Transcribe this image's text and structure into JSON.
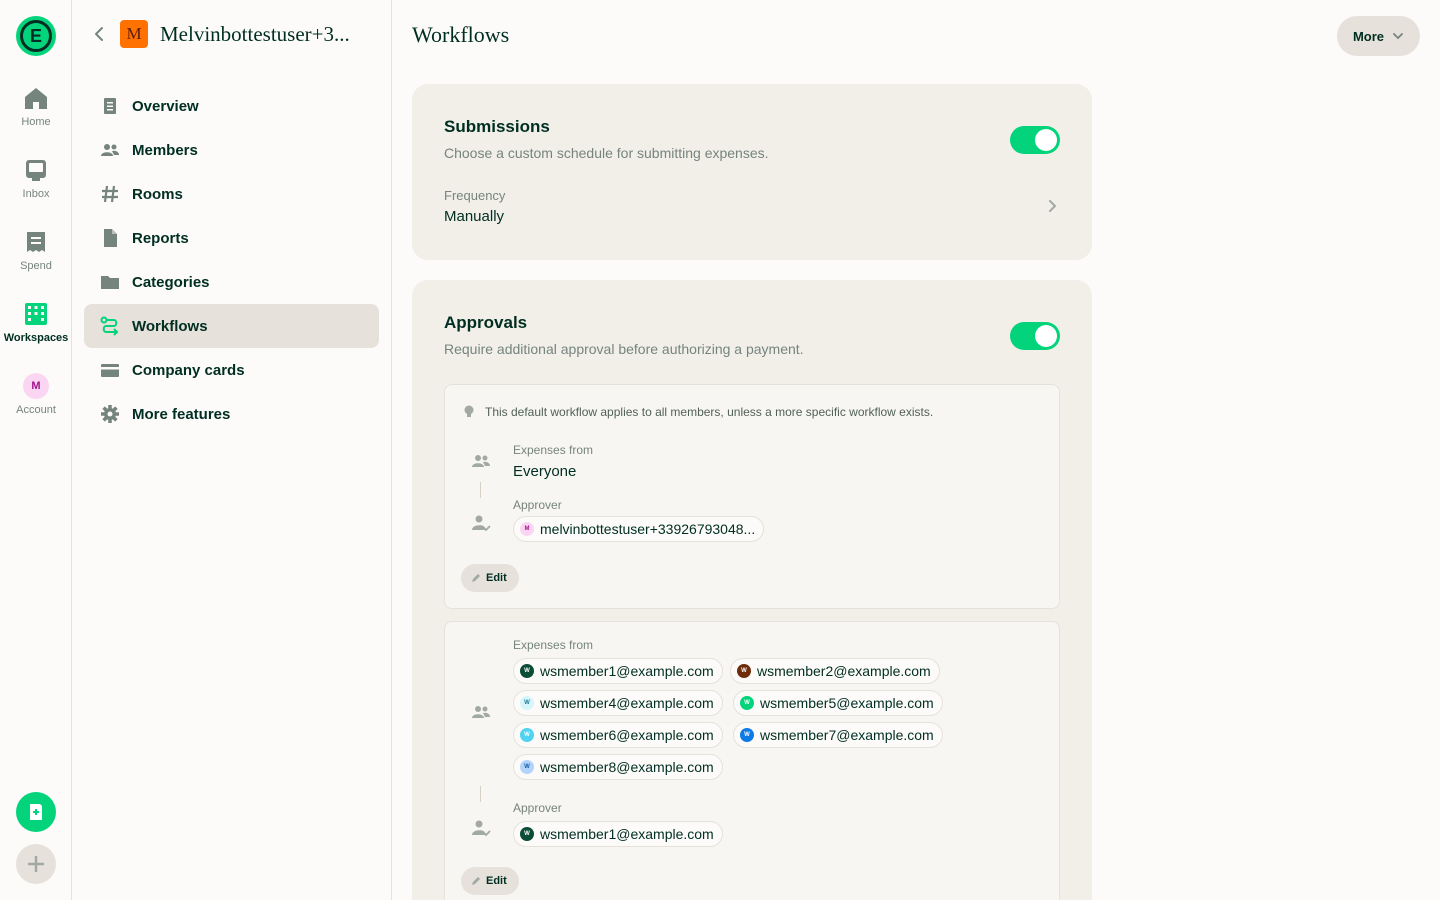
{
  "rail": {
    "logo_letter": "E",
    "items": [
      {
        "label": "Home",
        "icon": "home-icon"
      },
      {
        "label": "Inbox",
        "icon": "inbox-icon"
      },
      {
        "label": "Spend",
        "icon": "receipt-icon"
      },
      {
        "label": "Workspaces",
        "icon": "building-icon",
        "active": true
      },
      {
        "label": "Account",
        "icon": "avatar",
        "avatar_letter": "M"
      }
    ]
  },
  "sidebar": {
    "workspace_initial": "M",
    "workspace_name": "Melvinbottestuser+3...",
    "items": [
      {
        "label": "Overview",
        "icon": "document-icon"
      },
      {
        "label": "Members",
        "icon": "users-icon"
      },
      {
        "label": "Rooms",
        "icon": "hashtag-icon"
      },
      {
        "label": "Reports",
        "icon": "file-icon"
      },
      {
        "label": "Categories",
        "icon": "folder-icon"
      },
      {
        "label": "Workflows",
        "icon": "workflow-icon",
        "active": true
      },
      {
        "label": "Company cards",
        "icon": "credit-card-icon"
      },
      {
        "label": "More features",
        "icon": "gear-icon"
      }
    ]
  },
  "header": {
    "title": "Workflows",
    "more_label": "More"
  },
  "submissions": {
    "title": "Submissions",
    "description": "Choose a custom schedule for submitting expenses.",
    "enabled": true,
    "frequency_label": "Frequency",
    "frequency_value": "Manually"
  },
  "approvals": {
    "title": "Approvals",
    "description": "Require additional approval before authorizing a payment.",
    "enabled": true,
    "default_workflow": {
      "hint": "This default workflow applies to all members, unless a more specific workflow exists.",
      "expenses_from_label": "Expenses from",
      "expenses_from_value": "Everyone",
      "approver_label": "Approver",
      "approver": {
        "email": "melvinbottestuser+33926793048...",
        "initial": "M"
      },
      "edit_label": "Edit"
    },
    "custom_workflow": {
      "expenses_from_label": "Expenses from",
      "members": [
        {
          "email": "wsmember1@example.com",
          "initial": "W",
          "color": "#0b4d36",
          "text": "#ffffff"
        },
        {
          "email": "wsmember2@example.com",
          "initial": "W",
          "color": "#6e2c0b",
          "text": "#ffffff"
        },
        {
          "email": "wsmember4@example.com",
          "initial": "W",
          "color": "#d6f6fb",
          "text": "#1b7a9a"
        },
        {
          "email": "wsmember5@example.com",
          "initial": "W",
          "color": "#03d47c",
          "text": "#ffffff"
        },
        {
          "email": "wsmember6@example.com",
          "initial": "W",
          "color": "#4fd3f0",
          "text": "#ffffff"
        },
        {
          "email": "wsmember7@example.com",
          "initial": "W",
          "color": "#0f7ae6",
          "text": "#ffffff"
        },
        {
          "email": "wsmember8@example.com",
          "initial": "W",
          "color": "#b3d4fb",
          "text": "#1a5ba8"
        }
      ],
      "approver_label": "Approver",
      "approver": {
        "email": "wsmember1@example.com",
        "initial": "W",
        "color": "#0b4d36",
        "text": "#ffffff"
      },
      "edit_label": "Edit"
    }
  },
  "colors": {
    "accent": "#03d47c",
    "text": "#002e22",
    "muted": "#76847e",
    "card": "#f2efe9",
    "border": "#e6e1da"
  }
}
